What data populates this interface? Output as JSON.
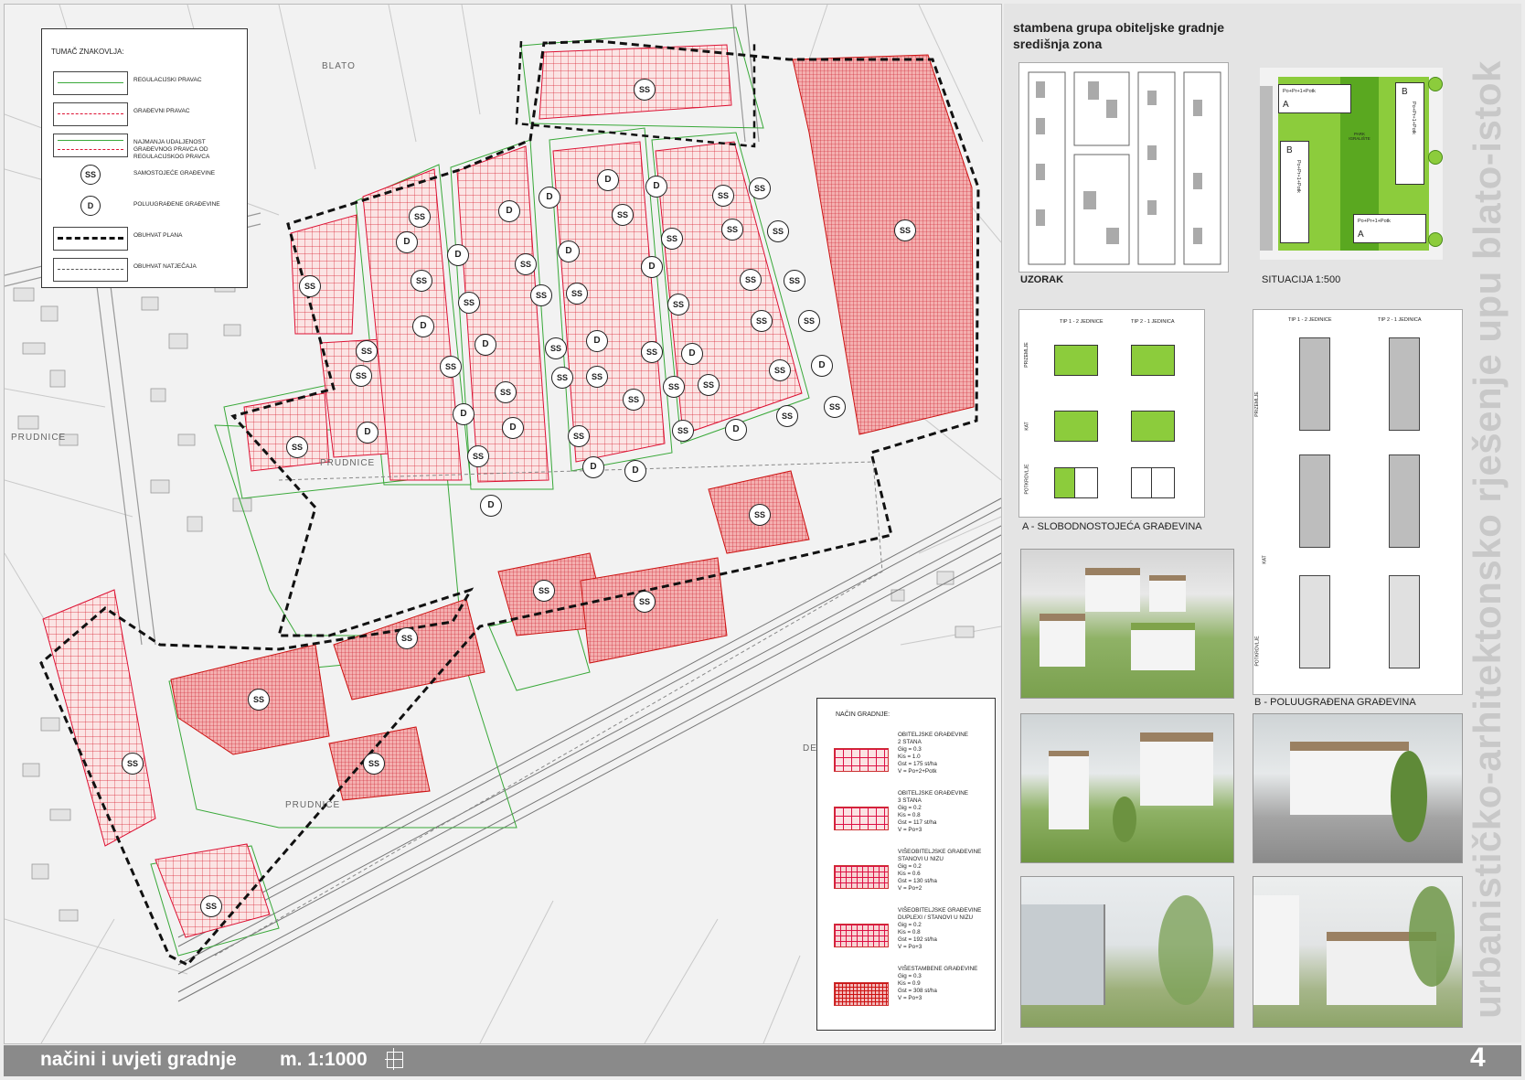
{
  "map": {
    "legend_title": "TUMAČ ZNAKOVLJA:",
    "legend_items": [
      {
        "label": "REGULACIJSKI PRAVAC"
      },
      {
        "label": "GRAĐEVNI PRAVAC"
      },
      {
        "label": "NAJMANJA UDALJENOST GRAĐEVNOG PRAVCA OD REGULACIJSKOG PRAVCA"
      },
      {
        "label": "SAMOSTOJEĆE GRAĐEVINE",
        "symbol": "SS"
      },
      {
        "label": "POLUUGRAĐENE GRAĐEVINE",
        "symbol": "D"
      },
      {
        "label": "OBUHVAT PLANA"
      },
      {
        "label": "OBUHVAT NATJEČAJA"
      }
    ],
    "place_names": [
      "BLATO",
      "PRUDNICE",
      "PRUDNICE",
      "PRUDNICE",
      "DE"
    ],
    "symbol_ss": "SS",
    "symbol_d": "D",
    "legend2_title": "NAČIN GRADNJE:",
    "legend2_items": [
      {
        "text": "OBITELJSKE GRAĐEVINE\n2 STANA\nGig = 0.3\nKis = 1.0\nGst = 175 st/ha\nV = Po+2+Potk",
        "pattern": "light"
      },
      {
        "text": "OBITELJSKE GRAĐEVINE\n3 STANA\nGig = 0.2\nKis = 0.8\nGst = 117 st/ha\nV = Po+3",
        "pattern": "light"
      },
      {
        "text": "VIŠEOBITELJSKE GRAĐEVINE\nSTANOVI U NIZU\nGig = 0.2\nKis = 0.6\nGst = 130 st/ha\nV = Po+2",
        "pattern": "med"
      },
      {
        "text": "VIŠEOBITELJSKE GRAĐEVINE\nDUPLEXI / STANOVI U NIZU\nGig = 0.2\nKis = 0.8\nGst = 192 st/ha\nV = Po+3",
        "pattern": "med"
      },
      {
        "text": "VIŠESTAMBENE GRAĐEVINE\nGig = 0.3\nKis = 0.9\nGst = 308 st/ha\nV = Po+3",
        "pattern": "dense"
      }
    ]
  },
  "panel": {
    "heading_line1": "stambena grupa obiteljske gradnje",
    "heading_line2": "središnja zona",
    "uzorak_label": "UZORAK",
    "situacija_label": "SITUACIJA 1:500",
    "situ_a_text": "Po+Pr+1+Potk",
    "situ_b_text": "Po+Pr+1+Potk",
    "situ_a2_text": "Po+Pr+1+Potk",
    "situ_b2_text": "Po+Pr+1+Potk",
    "situ_letter_a": "A",
    "situ_letter_b": "B",
    "situ_center_text": "PARK IGRALIŠTE",
    "plan_a": {
      "tip1": "TIP 1 - 2 JEDINICE",
      "tip2": "TIP 2 - 1 JEDINICA",
      "rows": [
        "PRIZEMLJE",
        "KAT",
        "POTKROVLJE"
      ],
      "caption": "A - SLOBODNOSTOJEĆA GRAĐEVINA"
    },
    "plan_b": {
      "tip1": "TIP 1 - 2 JEDINICE",
      "tip2": "TIP 2 - 1 JEDINICA",
      "rows": [
        "PRIZEMLJE",
        "KAT",
        "POTKROVLJE"
      ],
      "caption": "B - POLUUGRAĐENA GRAĐEVINA"
    },
    "vertical_title": "urbanističko-arhitektonsko rješenje upu blato-istok"
  },
  "footer": {
    "title": "načini i uvjeti gradnje",
    "scale": "m. 1:1000",
    "sheet_number": "4"
  },
  "colors": {
    "red_hatch": "#d11a2a",
    "green_lines": "#3aaa3a",
    "bar_gray": "#8a8a8a",
    "lime": "#8ccc3c"
  }
}
